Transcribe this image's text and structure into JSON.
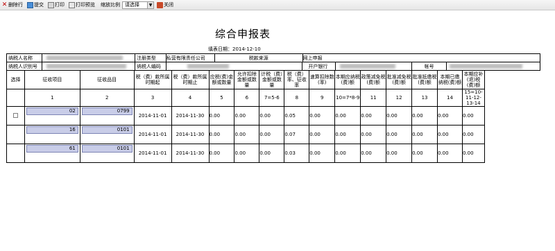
{
  "toolbar": {
    "delete_row": "删除行",
    "submit": "提交",
    "print": "打印",
    "print_preview": "打印预览",
    "zoom_label": "缩放比例",
    "zoom_value": "请选择",
    "close": "关闭"
  },
  "title": "综合申报表",
  "fill_date": "填表日期：2014-12-10",
  "info": {
    "taxpayer_name_label": "纳税人名称",
    "reg_type_label": "注册类型",
    "reg_type_value": "私营有限责任公司",
    "tax_source_label": "税款来源",
    "tax_source_value": "网上申报",
    "taxpayer_id_label": "纳税人识别号",
    "taxpayer_code_label": "纳税人编码",
    "bank_label": "开户银行",
    "account_label": "帐号"
  },
  "columns": [
    "选择",
    "征收项目",
    "征收品目",
    "税（费）款所属时期起",
    "税（费）款所属时期止",
    "应税(费)金额或数量",
    "允许扣除金额或数量",
    "计税（费）金额或数量",
    "税（费）率、征收率",
    "速算扣除数(率)",
    "本期应纳税(费)额",
    "政策减免税(费)额",
    "批准减免税(费)额",
    "批准抵缴税(费)额",
    "本期已缴纳税(费)额",
    "本期应补(退)税(费)额"
  ],
  "column_numbers": [
    "",
    "1",
    "2",
    "3",
    "4",
    "5",
    "6",
    "7=5-6",
    "8",
    "9",
    "10=7*8-9",
    "11",
    "12",
    "13",
    "14",
    "15=10-11-12-13-14"
  ],
  "rows": [
    {
      "item": "02",
      "subitem": "0799",
      "start": "2014-11-01",
      "end": "2014-11-30",
      "c5": "0.00",
      "c6": "0.00",
      "c7": "0.00",
      "c8": "0.05",
      "c9": "0.00",
      "c10": "0.00",
      "c11": "0.00",
      "c12": "0.00",
      "c13": "0.00",
      "c14": "0.00",
      "c15": "0.00"
    },
    {
      "item": "16",
      "subitem": "0101",
      "start": "2014-11-01",
      "end": "2014-11-30",
      "c5": "0.00",
      "c6": "0.00",
      "c7": "0.00",
      "c8": "0.07",
      "c9": "0.00",
      "c10": "0.00",
      "c11": "0.00",
      "c12": "0.00",
      "c13": "0.00",
      "c14": "0.00",
      "c15": "0.00"
    },
    {
      "item": "61",
      "subitem": "0101",
      "start": "2014-11-01",
      "end": "2014-11-30",
      "c5": "0.00",
      "c6": "0.00",
      "c7": "0.00",
      "c8": "0.03",
      "c9": "0.00",
      "c10": "0.00",
      "c11": "0.00",
      "c12": "0.00",
      "c13": "0.00",
      "c14": "0.00",
      "c15": "0.00"
    }
  ]
}
